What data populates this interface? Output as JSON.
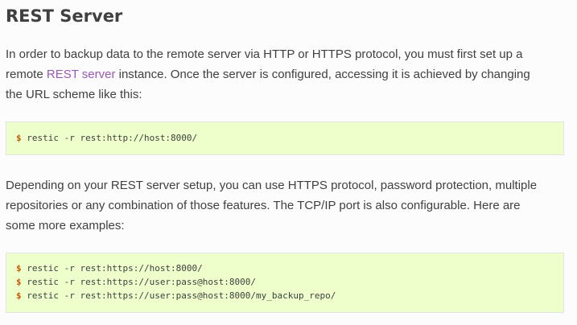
{
  "section": {
    "title": "REST Server"
  },
  "intro": {
    "line1": "In order to backup data to the remote server via HTTP or HTTPS protocol, you must first set up a",
    "line2_pre": "remote ",
    "line2_link": "REST server",
    "line2_post": " instance. Once the server is configured, accessing it is achieved by changing",
    "line3": "the URL scheme like this:"
  },
  "code_block_1": {
    "prompt": "$",
    "lines": [
      "restic -r rest:http://host:8000/"
    ]
  },
  "options": {
    "line1": "Depending on your REST server setup, you can use HTTPS protocol, password protection, multiple",
    "line2": "repositories or any combination of those features. The TCP/IP port is also configurable. Here are",
    "line3": "some more examples:"
  },
  "code_block_2": {
    "prompt": "$",
    "lines": [
      "restic -r rest:https://host:8000/",
      "restic -r rest:https://user:pass@host:8000/",
      "restic -r rest:https://user:pass@host:8000/my_backup_repo/"
    ]
  },
  "colors": {
    "link": "#9b59b6",
    "code_background": "#eeffcc",
    "prompt": "#c65d09",
    "text": "#404040"
  }
}
